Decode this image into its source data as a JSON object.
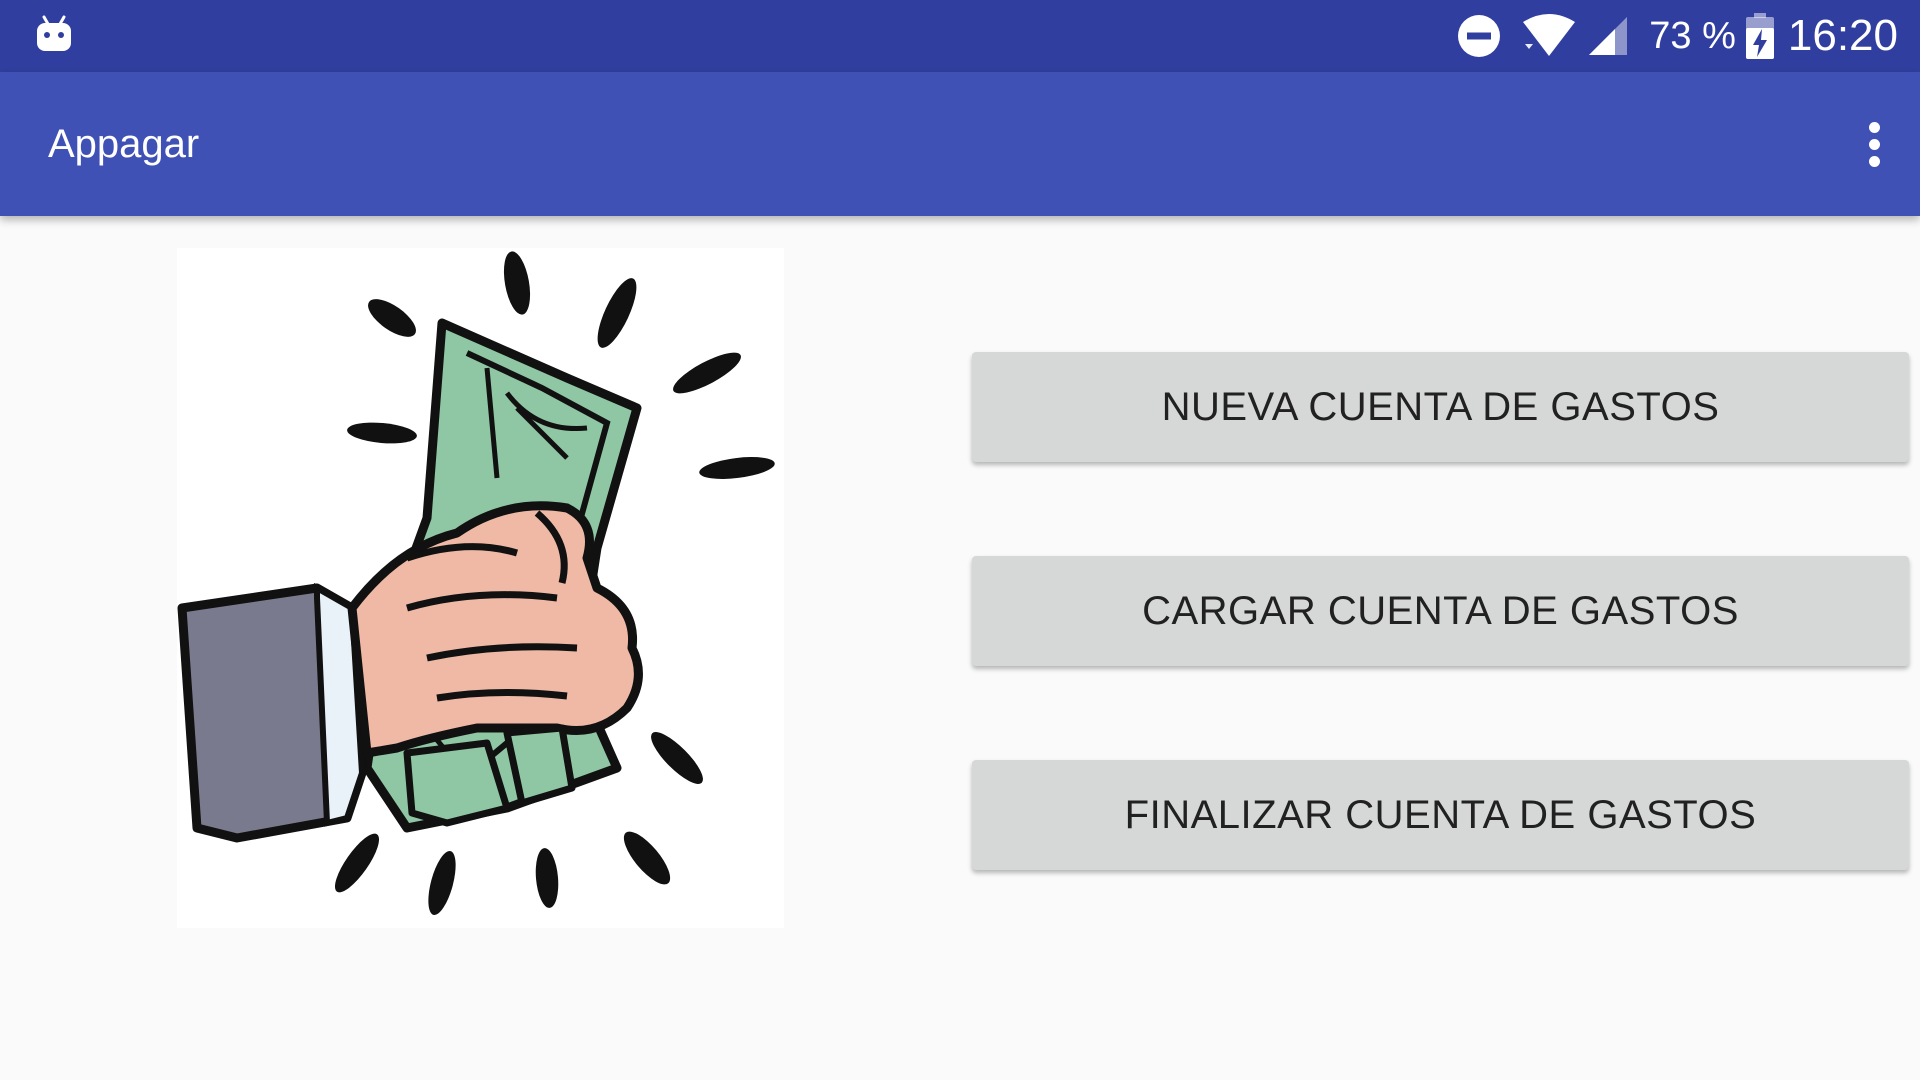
{
  "status_bar": {
    "battery_text": "73 %",
    "clock": "16:20",
    "icons": [
      "android-notification-icon",
      "do-not-disturb-icon",
      "wifi-icon",
      "cell-signal-icon",
      "battery-charging-icon"
    ]
  },
  "app_bar": {
    "title": "Appagar",
    "menu_icon": "more-vert-icon"
  },
  "main": {
    "image": "hand-holding-money-icon",
    "buttons": [
      {
        "label": "NUEVA CUENTA DE GASTOS"
      },
      {
        "label": "CARGAR CUENTA DE GASTOS"
      },
      {
        "label": "FINALIZAR CUENTA DE GASTOS"
      }
    ]
  },
  "colors": {
    "status_bar": "#303f9f",
    "app_bar": "#3f51b5",
    "background": "#fafafa",
    "button": "#d6d7d7",
    "button_text": "#212121",
    "money": "#8fc6a3",
    "skin": "#efb9a6",
    "sleeve": "#7a7a8e"
  }
}
